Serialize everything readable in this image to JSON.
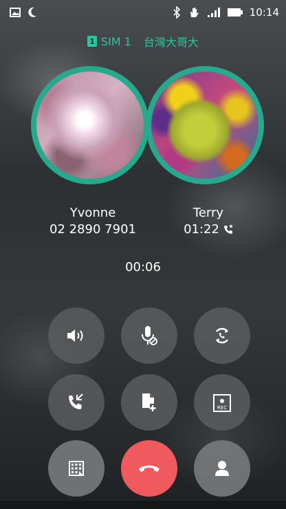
{
  "status_bar": {
    "time": "10:14",
    "left_icons": [
      "image-icon",
      "moon-icon"
    ],
    "right_icons": [
      "bluetooth-icon",
      "hand-icon",
      "signal-icon",
      "battery-icon"
    ]
  },
  "sim": {
    "badge": "1",
    "label": "SIM 1",
    "carrier": "台灣大哥大"
  },
  "callers": [
    {
      "name": "Yvonne",
      "number": "02 2890 7901"
    },
    {
      "name": "Terry",
      "duration": "01:22"
    }
  ],
  "call_duration": "00:06",
  "buttons": [
    {
      "name": "speaker-button",
      "icon": "speaker-icon"
    },
    {
      "name": "mute-button",
      "icon": "microphone-off-icon"
    },
    {
      "name": "swap-call-button",
      "icon": "swap-icon"
    },
    {
      "name": "merge-calls-button",
      "icon": "merge-call-icon"
    },
    {
      "name": "add-note-button",
      "icon": "note-icon"
    },
    {
      "name": "record-button",
      "icon": "rec-icon",
      "label": "REC"
    },
    {
      "name": "keypad-button",
      "icon": "keypad-icon"
    },
    {
      "name": "end-call-button",
      "icon": "end-call-icon"
    },
    {
      "name": "contacts-button",
      "icon": "person-icon"
    }
  ],
  "colors": {
    "accent": "#28c79e",
    "ring": "#26a98c",
    "end_call": "#f05a5e"
  }
}
